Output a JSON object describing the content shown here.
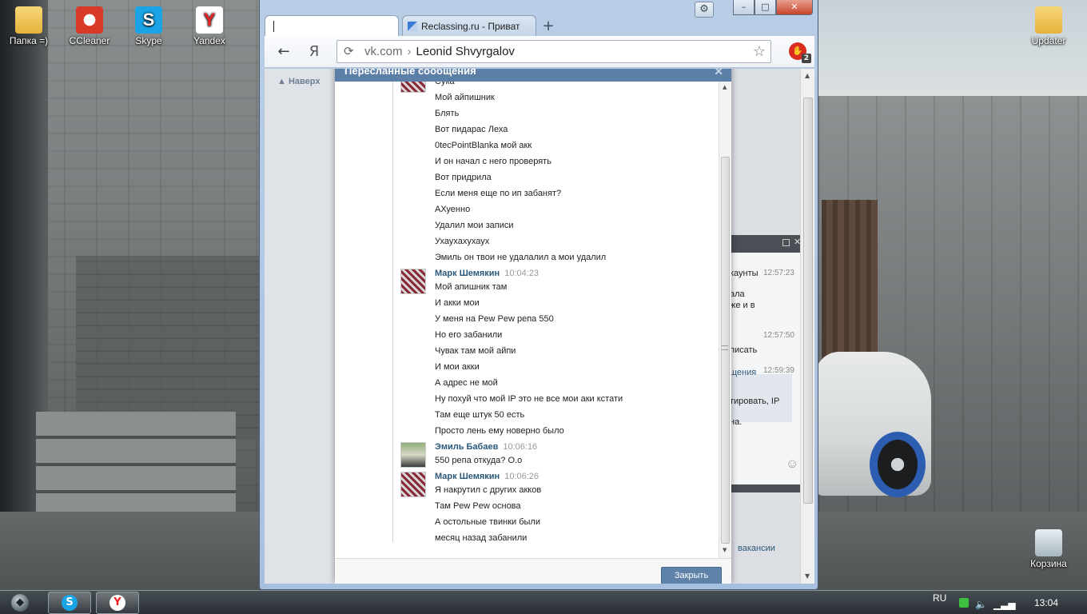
{
  "desktop": {
    "icons": [
      {
        "label": "Папка =)",
        "icon": "folder-icon"
      },
      {
        "label": "CCleaner",
        "icon": "ccleaner-icon"
      },
      {
        "label": "Skype",
        "icon": "skype-icon"
      },
      {
        "label": "Yandex",
        "icon": "yandex-icon"
      },
      {
        "label": "Updater",
        "icon": "folder-icon"
      },
      {
        "label": "Корзина",
        "icon": "recycle-bin-icon"
      }
    ]
  },
  "taskbar": {
    "language": "RU",
    "clock": "13:04",
    "pinned": [
      {
        "name": "Skype",
        "glyph": "S"
      },
      {
        "name": "Yandex",
        "glyph": "Y"
      }
    ]
  },
  "browser": {
    "tabs": [
      {
        "title": ""
      },
      {
        "title": "Reclassing.ru - Приват"
      }
    ],
    "new_tab_glyph": "+",
    "omnibox": {
      "host": "vk.com",
      "separator": "›",
      "path": "Leonid Shvyrgalov"
    },
    "yandex_glyph": "Я",
    "extension_badge": "2",
    "window_buttons": {
      "minimize": "–",
      "maximize": "□",
      "close": "✕"
    }
  },
  "page": {
    "back_to_top": "▲ Наверх",
    "bg_chat": [
      {
        "text": "каунты",
        "time": "12:57:23"
      },
      {
        "text": "ала",
        "time": ""
      },
      {
        "text": "же и в",
        "time": ""
      },
      {
        "text": "",
        "time": "12:57:50"
      },
      {
        "text": "писать",
        "time": ""
      },
      {
        "text": "щения",
        "time": "12:59:39"
      },
      {
        "text": "тировать, IP",
        "time": ""
      },
      {
        "text": "на.",
        "time": ""
      }
    ],
    "bg_link": "вакансии"
  },
  "dialog": {
    "title": "Пересланные сообщения",
    "close_glyph": "✕",
    "close_button": "Закрыть",
    "lines_top": [
      "Сука",
      "Мой айпишник",
      "Блять",
      "Вот пидарас Леха",
      "0tecPointBlanka мой акк",
      "И он начал с него проверять",
      "Вот придрила",
      "Если меня еще по ип забанят?",
      "АХуенно",
      "Удалил мои записи",
      "Ухаухахухаух",
      "Эмиль он твои не удалалил а мои удалил"
    ],
    "groups": [
      {
        "author": "Марк Шемякин",
        "time": "10:04:23",
        "avatar": "mark",
        "lines": [
          "Мой апишник там",
          "И акки мои",
          "У меня на Pew Pew репа 550",
          "Но его забанили",
          "Чувак там мой айпи",
          "И мои акки",
          "А адрес не мой",
          "Ну похуй что мой IP это не все мои аки кстати",
          "Там еще штук 50 есть",
          "Просто лень ему новерно было"
        ]
      },
      {
        "author": "Эмиль Бабаев",
        "time": "10:06:16",
        "avatar": "emil",
        "lines": [
          "550 репа откуда? О.о"
        ]
      },
      {
        "author": "Марк Шемякин",
        "time": "10:06:26",
        "avatar": "mark",
        "lines": [
          "Я накрутил с других акков",
          "Там Pew Pew основа",
          "А остольные твинки были",
          "месяц назад забанили"
        ]
      }
    ]
  }
}
